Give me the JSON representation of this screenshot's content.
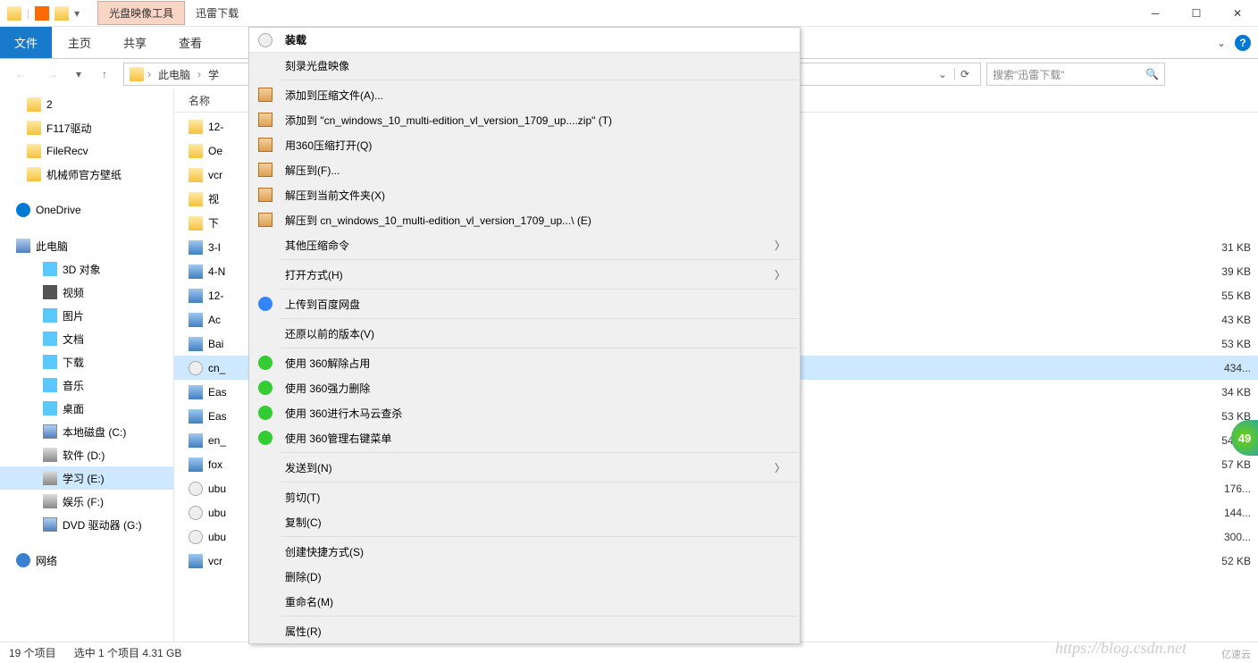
{
  "titlebar": {
    "tab1": "光盘映像工具",
    "tab2": "迅雷下载"
  },
  "ribbon": {
    "file": "文件",
    "tabs": [
      "主页",
      "共享",
      "查看"
    ]
  },
  "breadcrumb": {
    "items": [
      "此电脑",
      "学"
    ],
    "refresh_label": ""
  },
  "search": {
    "placeholder": "搜索\"迅雷下载\""
  },
  "sidebar": {
    "items": [
      {
        "label": "2",
        "cls": "i-folder",
        "lvl": "item"
      },
      {
        "label": "F117驱动",
        "cls": "i-folder",
        "lvl": "item"
      },
      {
        "label": "FileRecv",
        "cls": "i-folder",
        "lvl": "item"
      },
      {
        "label": "机械师官方壁纸",
        "cls": "i-folder",
        "lvl": "item"
      },
      {
        "label": "",
        "gap": true
      },
      {
        "label": "OneDrive",
        "cls": "i-onedrive",
        "lvl": "item root"
      },
      {
        "label": "",
        "gap": true
      },
      {
        "label": "此电脑",
        "cls": "i-pc",
        "lvl": "item root"
      },
      {
        "label": "3D 对象",
        "cls": "i-3d",
        "lvl": "item sub"
      },
      {
        "label": "视频",
        "cls": "i-video",
        "lvl": "item sub"
      },
      {
        "label": "图片",
        "cls": "i-pic",
        "lvl": "item sub"
      },
      {
        "label": "文档",
        "cls": "i-docf",
        "lvl": "item sub"
      },
      {
        "label": "下载",
        "cls": "i-down",
        "lvl": "item sub"
      },
      {
        "label": "音乐",
        "cls": "i-music",
        "lvl": "item sub"
      },
      {
        "label": "桌面",
        "cls": "i-desk",
        "lvl": "item sub"
      },
      {
        "label": "本地磁盘 (C:)",
        "cls": "i-drive",
        "lvl": "item sub"
      },
      {
        "label": "软件 (D:)",
        "cls": "i-disk",
        "lvl": "item sub"
      },
      {
        "label": "学习 (E:)",
        "cls": "i-disk",
        "lvl": "item sub",
        "sel": true
      },
      {
        "label": "娱乐 (F:)",
        "cls": "i-disk",
        "lvl": "item sub"
      },
      {
        "label": "DVD 驱动器 (G:)",
        "cls": "i-drive",
        "lvl": "item sub"
      },
      {
        "label": "",
        "gap": true
      },
      {
        "label": "网络",
        "cls": "i-net",
        "lvl": "item root"
      }
    ]
  },
  "filelist": {
    "header": "名称",
    "rows": [
      {
        "name": "12-",
        "cls": "i-folder"
      },
      {
        "name": "Oe",
        "cls": "i-folder"
      },
      {
        "name": "vcr",
        "cls": "i-folder"
      },
      {
        "name": "视",
        "cls": "i-folder"
      },
      {
        "name": "下",
        "cls": "i-folder"
      },
      {
        "name": "3-I",
        "cls": "i-exe",
        "size": "31 KB"
      },
      {
        "name": "4-N",
        "cls": "i-exe",
        "size": "39 KB"
      },
      {
        "name": "12-",
        "cls": "i-exe",
        "size": "55 KB"
      },
      {
        "name": "Ac",
        "cls": "i-exe",
        "size": "43 KB"
      },
      {
        "name": "Bai",
        "cls": "i-exe",
        "size": "53 KB"
      },
      {
        "name": "cn_",
        "cls": "i-iso",
        "size": "434...",
        "sel": true
      },
      {
        "name": "Eas",
        "cls": "i-exe",
        "size": "34 KB"
      },
      {
        "name": "Eas",
        "cls": "i-exe",
        "size": "53 KB"
      },
      {
        "name": "en_",
        "cls": "i-exe",
        "size": "54 KB"
      },
      {
        "name": "fox",
        "cls": "i-exe",
        "size": "57 KB"
      },
      {
        "name": "ubu",
        "cls": "i-iso",
        "size": "176..."
      },
      {
        "name": "ubu",
        "cls": "i-iso",
        "size": "144..."
      },
      {
        "name": "ubu",
        "cls": "i-iso",
        "size": "300..."
      },
      {
        "name": "vcr",
        "cls": "i-exe",
        "size": "52 KB"
      }
    ]
  },
  "contextmenu": {
    "items": [
      {
        "label": "装载",
        "bold": true,
        "cls": "i-iso"
      },
      {
        "label": "刻录光盘映像"
      },
      {
        "sep": true
      },
      {
        "label": "添加到压缩文件(A)...",
        "cls": "i-zip"
      },
      {
        "label": "添加到 \"cn_windows_10_multi-edition_vl_version_1709_up....zip\" (T)",
        "cls": "i-zip"
      },
      {
        "label": "用360压缩打开(Q)",
        "cls": "i-zip"
      },
      {
        "label": "解压到(F)...",
        "cls": "i-zip"
      },
      {
        "label": "解压到当前文件夹(X)",
        "cls": "i-zip"
      },
      {
        "label": "解压到 cn_windows_10_multi-edition_vl_version_1709_up...\\ (E)",
        "cls": "i-zip"
      },
      {
        "label": "其他压缩命令",
        "arrow": true
      },
      {
        "sep": true
      },
      {
        "label": "打开方式(H)",
        "arrow": true
      },
      {
        "sep": true
      },
      {
        "label": "上传到百度网盘",
        "cls": "i-baidu"
      },
      {
        "sep": true
      },
      {
        "label": "还原以前的版本(V)"
      },
      {
        "sep": true
      },
      {
        "label": "使用 360解除占用",
        "cls": "i-360"
      },
      {
        "label": "使用 360强力删除",
        "cls": "i-360"
      },
      {
        "label": "使用 360进行木马云查杀",
        "cls": "i-360"
      },
      {
        "label": "使用 360管理右键菜单",
        "cls": "i-360"
      },
      {
        "sep": true
      },
      {
        "label": "发送到(N)",
        "arrow": true
      },
      {
        "sep": true
      },
      {
        "label": "剪切(T)"
      },
      {
        "label": "复制(C)"
      },
      {
        "sep": true
      },
      {
        "label": "创建快捷方式(S)"
      },
      {
        "label": "删除(D)"
      },
      {
        "label": "重命名(M)"
      },
      {
        "sep": true
      },
      {
        "label": "属性(R)"
      }
    ]
  },
  "statusbar": {
    "count": "19 个项目",
    "selection": "选中 1 个项目  4.31 GB"
  },
  "watermark": "https://blog.csdn.net",
  "wmlogo": "亿速云",
  "badge": "49"
}
